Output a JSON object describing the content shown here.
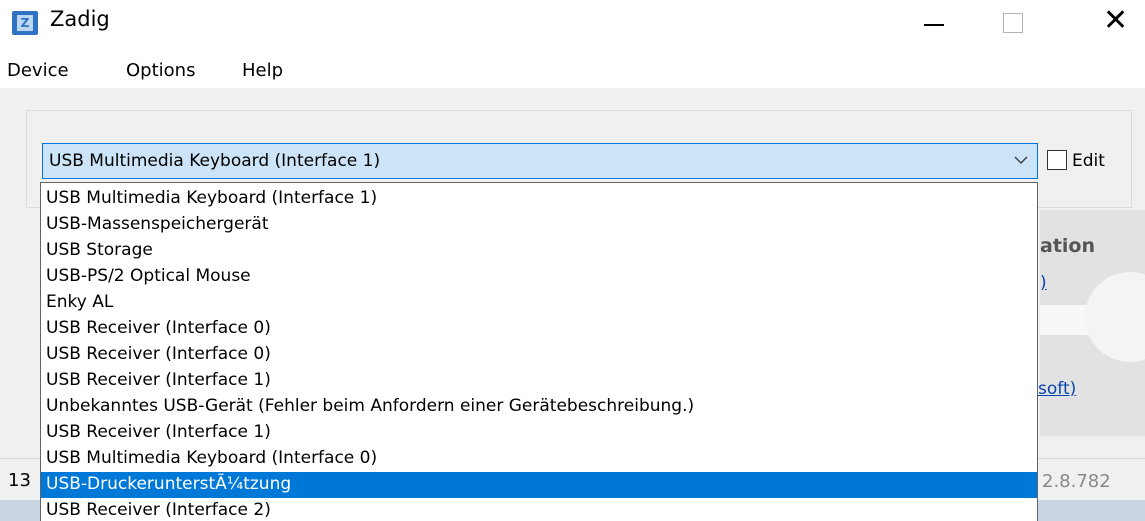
{
  "window": {
    "title": "Zadig",
    "icon": "zadig-app-icon",
    "icon_letter": "Z",
    "controls": [
      "minimize-icon",
      "maximize-icon",
      "close-icon"
    ],
    "close_glyph": "✕"
  },
  "menu": {
    "items": [
      {
        "label": "Device"
      },
      {
        "label": "Options"
      },
      {
        "label": "Help"
      }
    ]
  },
  "device_select": {
    "value": "USB Multimedia Keyboard (Interface 1)",
    "edit_label": "Edit",
    "edit_checked": false,
    "options": [
      "USB Multimedia Keyboard (Interface 1)",
      "USB-Massenspeichergerät",
      "USB Storage",
      "USB-PS/2 Optical Mouse",
      "Enky AL",
      "USB Receiver (Interface 0)",
      "USB Receiver (Interface 0)",
      "USB Receiver (Interface 1)",
      "Unbekanntes USB-Gerät (Fehler beim Anfordern einer Gerätebeschreibung.)",
      "USB Receiver (Interface 1)",
      "USB Multimedia Keyboard (Interface 0)",
      "USB-DruckerunterstÃ¼tzung",
      "USB Receiver (Interface 2)"
    ],
    "highlighted_index": 11
  },
  "background_panel": {
    "heading": "ation",
    "link1": ")",
    "link2": "soft)"
  },
  "status": {
    "left": "13",
    "version": "2.8.782"
  },
  "colors": {
    "accent": "#0078d7",
    "combo_bg": "#cce4f7",
    "link": "#0645ad"
  }
}
